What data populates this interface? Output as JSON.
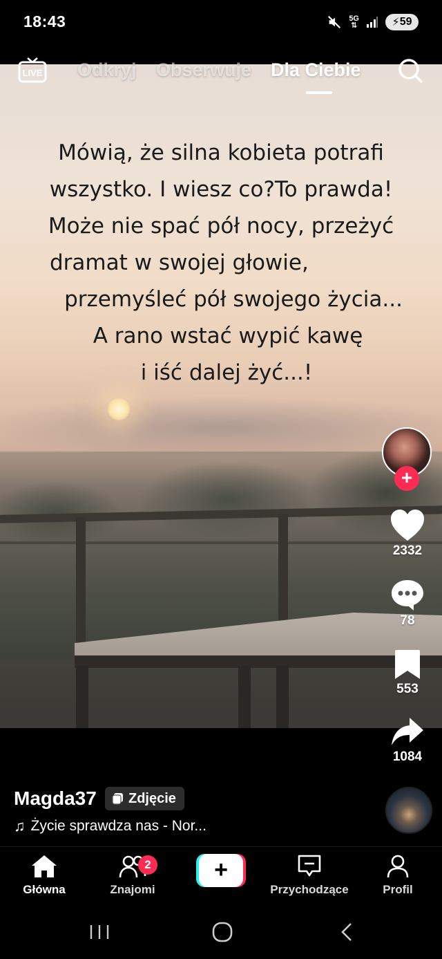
{
  "status_bar": {
    "time": "18:43",
    "network": "5G",
    "battery": "59"
  },
  "top_nav": {
    "live_label": "LIVE",
    "tabs": [
      {
        "label": "Odkryj",
        "active": false
      },
      {
        "label": "Obserwuje",
        "active": false
      },
      {
        "label": "Dla Ciebie",
        "active": true
      }
    ]
  },
  "post": {
    "quote_lines": [
      "Mówią, że silna kobieta potrafi",
      "wszystko. I wiesz co?To prawda!",
      "Może nie spać pół nocy, przeżyć",
      "dramat w swojej głowie,",
      "przemyśleć pół swojego życia...",
      "A rano wstać wypić kawę",
      "i iść dalej żyć...!"
    ],
    "author": "Magda37",
    "type_badge": "Zdjęcie",
    "music": "Życie sprawdza nas - Nor..."
  },
  "actions": {
    "likes": "2332",
    "comments": "78",
    "saves": "553",
    "shares": "1084"
  },
  "tab_bar": {
    "home": "Główna",
    "friends": "Znajomi",
    "friends_badge": "2",
    "create": "+",
    "inbox": "Przychodzące",
    "profile": "Profil"
  },
  "colors": {
    "accent_red": "#fe2c55",
    "accent_cyan": "#25f4ee",
    "background": "#000000"
  }
}
